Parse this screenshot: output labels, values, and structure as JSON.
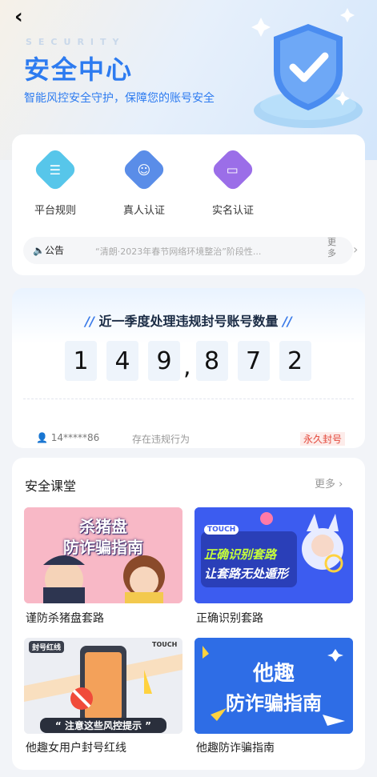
{
  "header": {
    "back_icon": "chevron-left-icon",
    "watermark": "SECURITY",
    "title": "安全中心",
    "subtitle": "智能风控安全守护，保障您的账号安全"
  },
  "features": [
    {
      "label": "平台规则",
      "icon": "list-icon",
      "color": "#4fc3e8"
    },
    {
      "label": "真人认证",
      "icon": "user-check-icon",
      "color": "#5a8de8"
    },
    {
      "label": "实名认证",
      "icon": "id-card-icon",
      "color": "#9b6ee8"
    }
  ],
  "notice": {
    "badge": "公告",
    "text": "“清朗·2023年春节网络环境整治”阶段性...",
    "more": "更多"
  },
  "stats": {
    "title": "近一季度处理违规封号账号数量",
    "digits": [
      "1",
      "4",
      "9",
      "8",
      "7",
      "2"
    ],
    "separator": ",",
    "record": {
      "user": "14*****86",
      "reason": "存在违规行为",
      "status": "永久封号"
    }
  },
  "course": {
    "title": "安全课堂",
    "more": "更多",
    "items": [
      {
        "caption": "谨防杀猪盘套路",
        "art_line1": "杀猪盘",
        "art_line2": "防诈骗指南"
      },
      {
        "caption": "正确识别套路",
        "art_tag": "TOUCH",
        "art_line1": "正确识别套路",
        "art_line2": "让套路无处遁形"
      },
      {
        "caption": "他趣女用户封号红线",
        "art_tag": "封号红线",
        "art_tag2": "TOUCH",
        "art_line1": "注意这些风控提示"
      },
      {
        "caption": "他趣防诈骗指南",
        "art_line1": "他趣",
        "art_line2": "防诈骗指南"
      }
    ]
  },
  "colors": {
    "primary": "#2d7bf0",
    "danger": "#e3473a"
  }
}
